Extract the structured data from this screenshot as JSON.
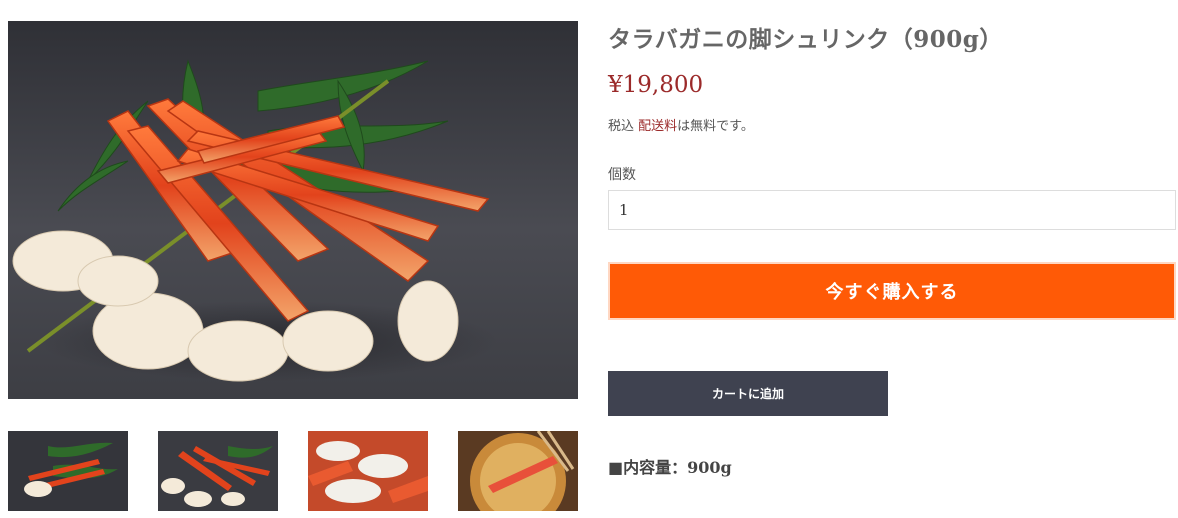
{
  "product": {
    "title": "タラバガニの脚シュリンク（900g）",
    "price": "¥19,800",
    "tax_label": "税込",
    "shipping_link": "配送料",
    "shipping_suffix": "は無料です。",
    "quantity_label": "個数",
    "quantity_value": "1",
    "buy_now_label": "今すぐ購入する",
    "add_to_cart_label": "カートに追加",
    "content_line": "■内容量：900g"
  },
  "colors": {
    "price": "#9b2a2a",
    "buy_button": "#ff5a06",
    "cart_button": "#3f4250",
    "title": "#666666"
  },
  "images": {
    "main": "king-crab-legs-on-bamboo-leaves",
    "thumbnails": [
      "crab-legs-bamboo-small",
      "crab-legs-pile",
      "crab-legs-closeup",
      "crab-leg-frying-tempura"
    ]
  }
}
